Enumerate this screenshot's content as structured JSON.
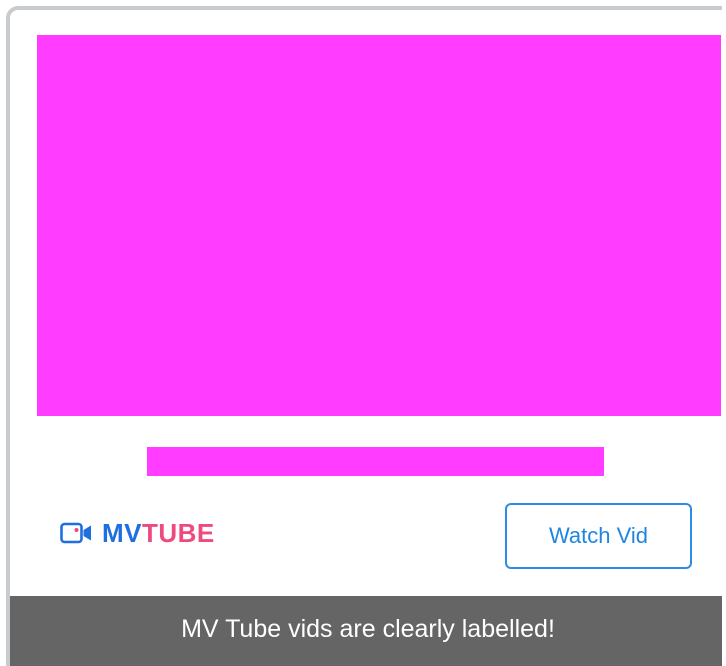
{
  "card": {
    "thumbnail_color": "#ff3cff",
    "title": "",
    "logo": {
      "icon": "video-camera-icon",
      "brand_part1": "MV",
      "brand_part2": "TUBE",
      "brand_part1_color": "#1f6fe0",
      "brand_part2_color": "#ef4a7d"
    },
    "watch_button_label": "Watch Vid",
    "watch_button_color": "#2b8ee6"
  },
  "banner": {
    "text": "MV Tube vids are clearly labelled!",
    "background": "#656565"
  }
}
